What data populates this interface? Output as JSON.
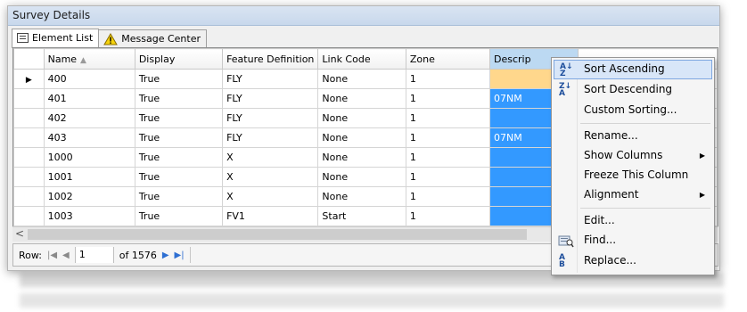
{
  "window": {
    "title": "Survey Details"
  },
  "tabs": [
    {
      "label": "Element List"
    },
    {
      "label": "Message Center"
    }
  ],
  "grid": {
    "columns": [
      "Name",
      "Display",
      "Feature Definition",
      "Link Code",
      "Zone",
      "Descrip"
    ],
    "rows": [
      {
        "name": "400",
        "display": "True",
        "feature": "FLY",
        "link": "None",
        "zone": "1",
        "desc": ""
      },
      {
        "name": "401",
        "display": "True",
        "feature": "FLY",
        "link": "None",
        "zone": "1",
        "desc": "07NM"
      },
      {
        "name": "402",
        "display": "True",
        "feature": "FLY",
        "link": "None",
        "zone": "1",
        "desc": ""
      },
      {
        "name": "403",
        "display": "True",
        "feature": "FLY",
        "link": "None",
        "zone": "1",
        "desc": "07NM"
      },
      {
        "name": "1000",
        "display": "True",
        "feature": "X",
        "link": "None",
        "zone": "1",
        "desc": ""
      },
      {
        "name": "1001",
        "display": "True",
        "feature": "X",
        "link": "None",
        "zone": "1",
        "desc": ""
      },
      {
        "name": "1002",
        "display": "True",
        "feature": "X",
        "link": "None",
        "zone": "1",
        "desc": ""
      },
      {
        "name": "1003",
        "display": "True",
        "feature": "FV1",
        "link": "Start",
        "zone": "1",
        "desc": ""
      }
    ],
    "current_row_marker": "▶",
    "sort_glyph": "▲",
    "colors": {
      "selected_column": "#3399ff",
      "current_cell": "#ffd78c"
    }
  },
  "scroll": {
    "left_arrow": "<"
  },
  "navigator": {
    "row_label": "Row:",
    "first": "|◀",
    "prev": "◀",
    "current_row": "1",
    "of_label": "of 1576",
    "next": "▶",
    "last": "▶|"
  },
  "context_menu": {
    "items": [
      {
        "label": "Sort Ascending",
        "icon": "sort-ascending-icon"
      },
      {
        "label": "Sort Descending",
        "icon": "sort-descending-icon"
      },
      {
        "label": "Custom Sorting..."
      },
      {
        "label": "Rename..."
      },
      {
        "label": "Show Columns",
        "submenu": true
      },
      {
        "label": "Freeze This Column"
      },
      {
        "label": "Alignment",
        "submenu": true
      },
      {
        "label": "Edit..."
      },
      {
        "label": "Find...",
        "icon": "find-icon"
      },
      {
        "label": "Replace...",
        "icon": "replace-icon"
      }
    ],
    "sort_icon_top": "A↓",
    "sort_icon_bottom": "Z",
    "replace_icon_top": "A",
    "replace_icon_bottom": "B",
    "submenu_arrow": "▶"
  }
}
